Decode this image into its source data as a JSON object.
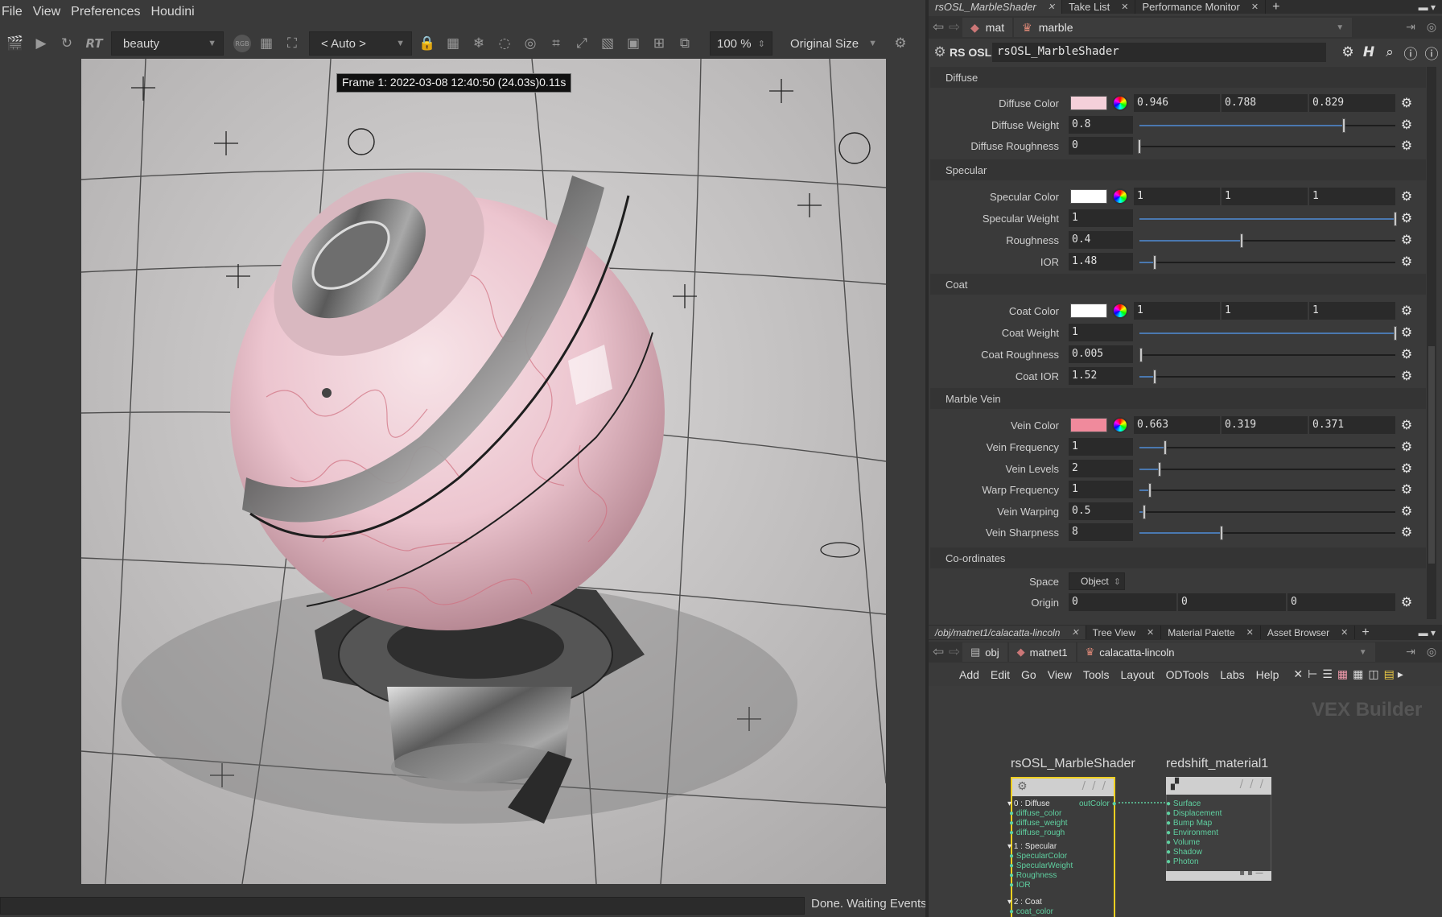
{
  "menubar": {
    "items": [
      "File",
      "View",
      "Preferences",
      "Houdini"
    ]
  },
  "viewer_toolbar": {
    "aov": "beauty",
    "camera": "< Auto >",
    "zoom": "100 %",
    "size_mode": "Original Size",
    "rt_label": "RT",
    "rgb_label": "RGB"
  },
  "frame_info": "Frame  1: 2022-03-08  12:40:50  (24.03s)0.11s",
  "status_text": "Done. Waiting Events",
  "right_tabs": [
    {
      "label": "rsOSL_MarbleShader",
      "active": true
    },
    {
      "label": "Take List",
      "active": false
    },
    {
      "label": "Performance Monitor",
      "active": false
    }
  ],
  "path": {
    "crumbs": [
      "mat",
      "marble"
    ]
  },
  "op": {
    "type": "RS OSL",
    "name": "rsOSL_MarbleShader"
  },
  "sections": {
    "diffuse": "Diffuse",
    "specular": "Specular",
    "coat": "Coat",
    "marble": "Marble Vein",
    "coords": "Co-ordinates"
  },
  "params": {
    "diffuse_color": {
      "label": "Diffuse Color",
      "r": "0.946",
      "g": "0.788",
      "b": "0.829",
      "swatch": "#f5d0da"
    },
    "diffuse_weight": {
      "label": "Diffuse Weight",
      "value": "0.8",
      "level": 0.8
    },
    "diffuse_roughness": {
      "label": "Diffuse Roughness",
      "value": "0",
      "level": 0
    },
    "specular_color": {
      "label": "Specular Color",
      "r": "1",
      "g": "1",
      "b": "1",
      "swatch": "#ffffff"
    },
    "specular_weight": {
      "label": "Specular Weight",
      "value": "1",
      "level": 1
    },
    "roughness": {
      "label": "Roughness",
      "value": "0.4",
      "level": 0.4
    },
    "ior": {
      "label": "IOR",
      "value": "1.48",
      "level": 0.06
    },
    "coat_color": {
      "label": "Coat Color",
      "r": "1",
      "g": "1",
      "b": "1",
      "swatch": "#ffffff"
    },
    "coat_weight": {
      "label": "Coat Weight",
      "value": "1",
      "level": 1
    },
    "coat_roughness": {
      "label": "Coat Roughness",
      "value": "0.005",
      "level": 0.005
    },
    "coat_ior": {
      "label": "Coat IOR",
      "value": "1.52",
      "level": 0.06
    },
    "vein_color": {
      "label": "Vein Color",
      "r": "0.663",
      "g": "0.319",
      "b": "0.371",
      "swatch": "#f08a9c"
    },
    "vein_frequency": {
      "label": "Vein Frequency",
      "value": "1",
      "level": 0.1
    },
    "vein_levels": {
      "label": "Vein Levels",
      "value": "2",
      "level": 0.08
    },
    "warp_frequency": {
      "label": "Warp Frequency",
      "value": "1",
      "level": 0.04
    },
    "vein_warping": {
      "label": "Vein Warping",
      "value": "0.5",
      "level": 0.02
    },
    "vein_sharpness": {
      "label": "Vein Sharpness",
      "value": "8",
      "level": 0.32
    },
    "space": {
      "label": "Space",
      "value": "Object"
    },
    "origin": {
      "label": "Origin",
      "x": "0",
      "y": "0",
      "z": "0"
    }
  },
  "network_tabs": [
    {
      "label": "/obj/matnet1/calacatta-lincoln",
      "active": true
    },
    {
      "label": "Tree View",
      "active": false
    },
    {
      "label": "Material Palette",
      "active": false
    },
    {
      "label": "Asset Browser",
      "active": false
    }
  ],
  "network_path": {
    "crumbs": [
      "obj",
      "matnet1",
      "calacatta-lincoln"
    ]
  },
  "network_menu": [
    "Add",
    "Edit",
    "Go",
    "View",
    "Tools",
    "Layout",
    "ODTools",
    "Labs",
    "Help"
  ],
  "network_context": "VEX Builder",
  "nodes": {
    "osl": {
      "title": "rsOSL_MarbleShader",
      "output": "outColor",
      "ports": [
        {
          "label": "0 : Diffuse",
          "header": true
        },
        {
          "label": "diffuse_color"
        },
        {
          "label": "diffuse_weight"
        },
        {
          "label": "diffuse_rough"
        },
        {
          "label": "1 : Specular",
          "header": true
        },
        {
          "label": "SpecularColor"
        },
        {
          "label": "SpecularWeight"
        },
        {
          "label": "Roughness"
        },
        {
          "label": "IOR"
        },
        {
          "label": "2 : Coat",
          "header": true
        },
        {
          "label": "coat_color"
        }
      ]
    },
    "rsmat": {
      "title": "redshift_material1",
      "ports": [
        "Surface",
        "Displacement",
        "Bump Map",
        "Environment",
        "Volume",
        "Shadow",
        "Photon"
      ]
    }
  },
  "colors": {
    "accent": "#4a78b0",
    "node_select": "#f0d020",
    "port": "#5fd0a0"
  }
}
